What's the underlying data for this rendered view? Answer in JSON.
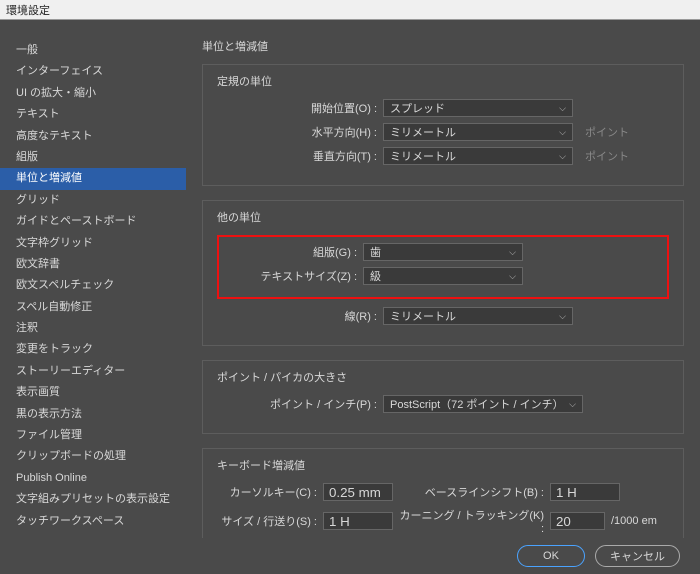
{
  "window": {
    "title": "環境設定"
  },
  "sidebar": {
    "items": [
      {
        "label": "一般"
      },
      {
        "label": "インターフェイス"
      },
      {
        "label": "UI の拡大・縮小"
      },
      {
        "label": "テキスト"
      },
      {
        "label": "高度なテキスト"
      },
      {
        "label": "組版"
      },
      {
        "label": "単位と増減値",
        "selected": true
      },
      {
        "label": "グリッド"
      },
      {
        "label": "ガイドとペーストボード"
      },
      {
        "label": "文字枠グリッド"
      },
      {
        "label": "欧文辞書"
      },
      {
        "label": "欧文スペルチェック"
      },
      {
        "label": "スペル自動修正"
      },
      {
        "label": "注釈"
      },
      {
        "label": "変更をトラック"
      },
      {
        "label": "ストーリーエディター"
      },
      {
        "label": "表示画質"
      },
      {
        "label": "黒の表示方法"
      },
      {
        "label": "ファイル管理"
      },
      {
        "label": "クリップボードの処理"
      },
      {
        "label": "Publish Online"
      },
      {
        "label": "文字組みプリセットの表示設定"
      },
      {
        "label": "タッチワークスペース"
      }
    ]
  },
  "content": {
    "page_title": "単位と増減値",
    "ruler": {
      "title": "定規の単位",
      "origin_label": "開始位置(O) :",
      "origin_value": "スプレッド",
      "horizontal_label": "水平方向(H) :",
      "horizontal_value": "ミリメートル",
      "horizontal_unit_suffix": "ポイント",
      "vertical_label": "垂直方向(T) :",
      "vertical_value": "ミリメートル",
      "vertical_unit_suffix": "ポイント"
    },
    "other": {
      "title": "他の単位",
      "typesetting_label": "組版(G) :",
      "typesetting_value": "歯",
      "textsize_label": "テキストサイズ(Z) :",
      "textsize_value": "級",
      "line_label": "線(R) :",
      "line_value": "ミリメートル"
    },
    "point": {
      "title": "ポイント / パイカの大きさ",
      "label": "ポイント / インチ(P) :",
      "value": "PostScript（72 ポイント / インチ）"
    },
    "keyboard": {
      "title": "キーボード増減値",
      "cursor_label": "カーソルキー(C) :",
      "cursor_value": "0.25 mm",
      "baseline_label": "ベースラインシフト(B) :",
      "baseline_value": "1 H",
      "size_label": "サイズ / 行送り(S) :",
      "size_value": "1 H",
      "kerning_label": "カーニング / トラッキング(K) :",
      "kerning_value": "20",
      "kerning_unit": "/1000 em"
    }
  },
  "buttons": {
    "ok": "OK",
    "cancel": "キャンセル"
  }
}
